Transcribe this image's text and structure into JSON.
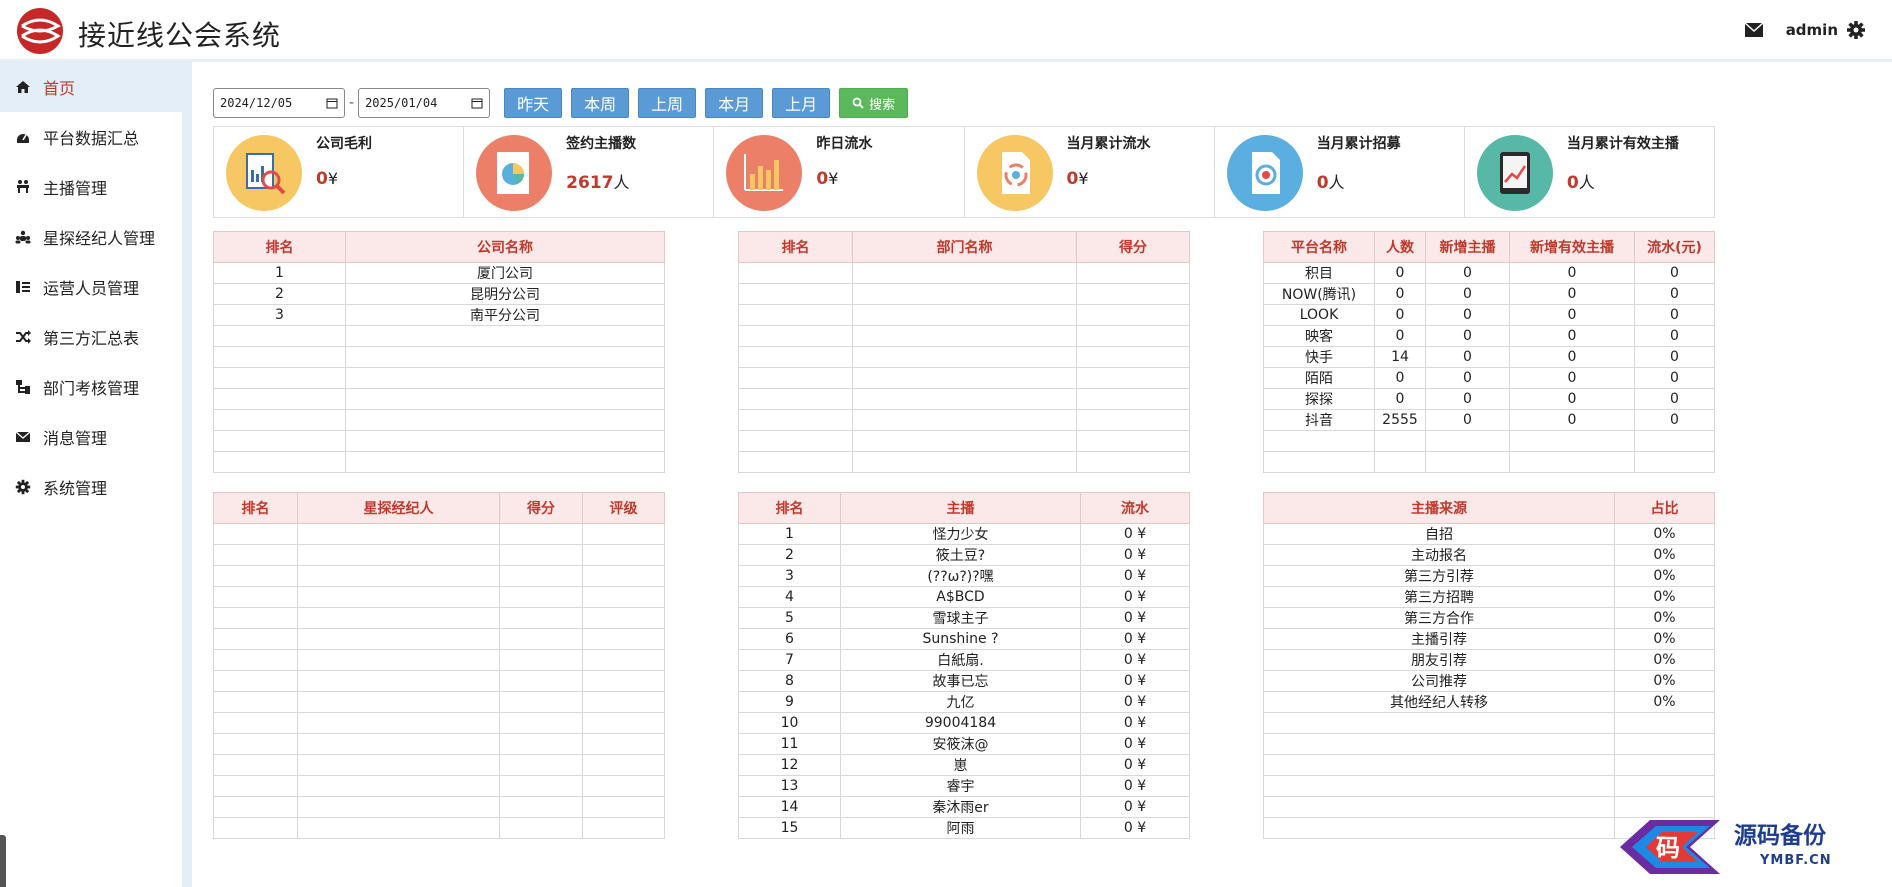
{
  "app": {
    "title": "接近线公会系统"
  },
  "header": {
    "user": "admin"
  },
  "sidebar": {
    "items": [
      {
        "label": "首页",
        "icon": "home-icon",
        "active": true
      },
      {
        "label": "平台数据汇总",
        "icon": "dashboard-icon"
      },
      {
        "label": "主播管理",
        "icon": "anchor-icon"
      },
      {
        "label": "星探经纪人管理",
        "icon": "group-icon"
      },
      {
        "label": "运营人员管理",
        "icon": "list-icon"
      },
      {
        "label": "第三方汇总表",
        "icon": "shuffle-icon"
      },
      {
        "label": "部门考核管理",
        "icon": "org-icon"
      },
      {
        "label": "消息管理",
        "icon": "mail-icon"
      },
      {
        "label": "系统管理",
        "icon": "gear-icon"
      }
    ]
  },
  "toolbar": {
    "start_date": "2024/12/05",
    "end_date": "2025/01/04",
    "separator": "-",
    "quick_buttons": [
      "昨天",
      "本周",
      "上周",
      "本月",
      "上月"
    ],
    "search_label": "搜索"
  },
  "stats": [
    {
      "label": "公司毛利",
      "value": "0",
      "unit": "¥",
      "color": "#f7c763"
    },
    {
      "label": "签约主播数",
      "value": "2617",
      "unit": "人",
      "color": "#ec7f67"
    },
    {
      "label": "昨日流水",
      "value": "0",
      "unit": "¥",
      "color": "#ec7f67"
    },
    {
      "label": "当月累计流水",
      "value": "0",
      "unit": "¥",
      "color": "#f7c763"
    },
    {
      "label": "当月累计招募",
      "value": "0",
      "unit": "人",
      "color": "#5aaee0"
    },
    {
      "label": "当月累计有效主播",
      "value": "0",
      "unit": "人",
      "color": "#57b8a8"
    }
  ],
  "company_table": {
    "headers": [
      "排名",
      "公司名称"
    ],
    "rows": [
      [
        "1",
        "厦门公司"
      ],
      [
        "2",
        "昆明分公司"
      ],
      [
        "3",
        "南平分公司"
      ]
    ]
  },
  "department_table": {
    "headers": [
      "排名",
      "部门名称",
      "得分"
    ],
    "rows": []
  },
  "platform_table": {
    "headers": [
      "平台名称",
      "人数",
      "新增主播",
      "新增有效主播",
      "流水(元)"
    ],
    "rows": [
      [
        "积目",
        "0",
        "0",
        "0",
        "0"
      ],
      [
        "NOW(腾讯)",
        "0",
        "0",
        "0",
        "0"
      ],
      [
        "LOOK",
        "0",
        "0",
        "0",
        "0"
      ],
      [
        "映客",
        "0",
        "0",
        "0",
        "0"
      ],
      [
        "快手",
        "14",
        "0",
        "0",
        "0"
      ],
      [
        "陌陌",
        "0",
        "0",
        "0",
        "0"
      ],
      [
        "探探",
        "0",
        "0",
        "0",
        "0"
      ],
      [
        "抖音",
        "2555",
        "0",
        "0",
        "0"
      ]
    ]
  },
  "scout_table": {
    "headers": [
      "排名",
      "星探经纪人",
      "得分",
      "评级"
    ],
    "rows": []
  },
  "anchor_table": {
    "headers": [
      "排名",
      "主播",
      "流水"
    ],
    "rows": [
      [
        "1",
        "怪力少女",
        "0 ¥"
      ],
      [
        "2",
        "筱土豆?",
        "0 ¥"
      ],
      [
        "3",
        "(??ω?)?嘿",
        "0 ¥"
      ],
      [
        "4",
        "A$BCD",
        "0 ¥"
      ],
      [
        "5",
        "雪球主子",
        "0 ¥"
      ],
      [
        "6",
        "Sunshine ?",
        "0 ¥"
      ],
      [
        "7",
        "白紙扇.",
        "0 ¥"
      ],
      [
        "8",
        "故事已忘",
        "0 ¥"
      ],
      [
        "9",
        "九亿",
        "0 ¥"
      ],
      [
        "10",
        "99004184",
        "0 ¥"
      ],
      [
        "11",
        "安筱沫@",
        "0 ¥"
      ],
      [
        "12",
        "崽",
        "0 ¥"
      ],
      [
        "13",
        "睿宇",
        "0 ¥"
      ],
      [
        "14",
        "秦沐雨er",
        "0 ¥"
      ],
      [
        "15",
        "阿雨",
        "0 ¥"
      ]
    ]
  },
  "source_table": {
    "headers": [
      "主播来源",
      "占比"
    ],
    "rows": [
      [
        "自招",
        "0%"
      ],
      [
        "主动报名",
        "0%"
      ],
      [
        "第三方引荐",
        "0%"
      ],
      [
        "第三方招聘",
        "0%"
      ],
      [
        "第三方合作",
        "0%"
      ],
      [
        "主播引荐",
        "0%"
      ],
      [
        "朋友引荐",
        "0%"
      ],
      [
        "公司推荐",
        "0%"
      ],
      [
        "其他经纪人转移",
        "0%"
      ]
    ]
  },
  "watermark": {
    "glyph": "码",
    "text": "源码备份",
    "sub": "YMBF.CN"
  }
}
